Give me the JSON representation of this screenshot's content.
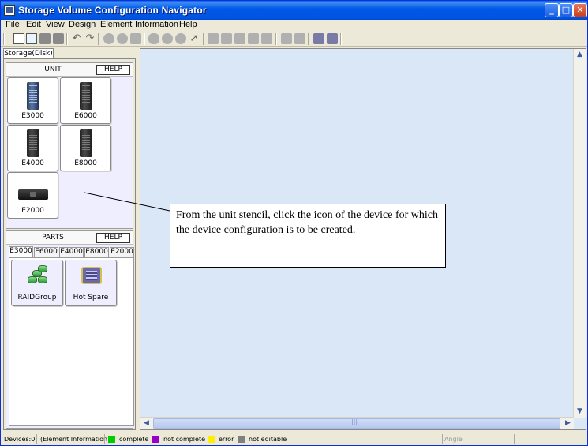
{
  "window": {
    "title": "Storage Volume Configuration Navigator"
  },
  "titlebar_buttons": {
    "minimize": "_",
    "maximize": "□",
    "close": "✕"
  },
  "menu": [
    "File",
    "Edit",
    "View",
    "Design",
    "Element",
    "Information",
    "Help"
  ],
  "toolbar_icons": [
    "new-file-icon",
    "open-folder-icon",
    "save-icon",
    "print-icon",
    "undo-icon",
    "redo-icon",
    "zoom-in-icon",
    "zoom-out-icon",
    "grid-icon",
    "pan-hand-icon",
    "zoom-region-icon",
    "zoom-fit-icon",
    "select-pointer-icon",
    "layout-icon",
    "connect-icon",
    "align-icon",
    "tree-icon",
    "link-icon",
    "hierarchy-icon",
    "hierarchy-alt-icon",
    "export-icon",
    "import-icon"
  ],
  "left_tab": "Storage(Disk)",
  "unit_stencil": {
    "title": "UNIT",
    "help": "HELP",
    "devices": [
      {
        "label": "E3000",
        "icon": "blue-tower-icon"
      },
      {
        "label": "E6000",
        "icon": "tower-icon"
      },
      {
        "label": "E4000",
        "icon": "tower-icon"
      },
      {
        "label": "E8000",
        "icon": "tower-icon"
      },
      {
        "label": "E2000",
        "icon": "rack-unit-icon"
      }
    ]
  },
  "parts_stencil": {
    "title": "PARTS",
    "help": "HELP",
    "tabs": [
      "E3000",
      "E6000",
      "E4000",
      "E8000",
      "E2000"
    ],
    "active_tab": "E3000",
    "parts": [
      {
        "label": "RAIDGroup",
        "icon": "raid-group-icon"
      },
      {
        "label": "Hot Spare",
        "icon": "hot-spare-icon"
      }
    ]
  },
  "callout": {
    "text": "From the unit stencil, click the icon of the device for which the device configuration is to be created."
  },
  "statusbar": {
    "devices": "Devices:0",
    "element_info": "(Element Information)",
    "legend": [
      {
        "label": "complete",
        "color": "#00cc00"
      },
      {
        "label": "not complete",
        "color": "#9900cc"
      },
      {
        "label": "error",
        "color": "#ffee00"
      },
      {
        "label": "not editable",
        "color": "#808080"
      }
    ],
    "angle": "Angle"
  }
}
